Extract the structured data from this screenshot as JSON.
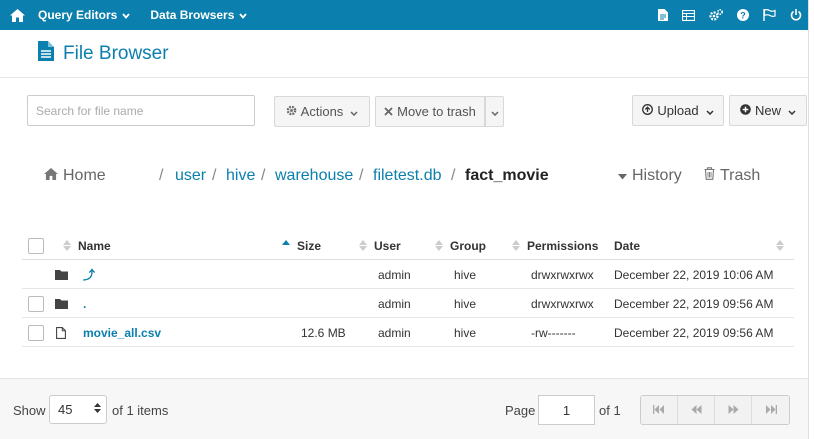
{
  "nav": {
    "query_editors": "Query Editors",
    "data_browsers": "Data Browsers"
  },
  "title": "File Browser",
  "toolbar": {
    "search_placeholder": "Search for file name",
    "actions": "Actions",
    "move_to_trash": "Move to trash",
    "upload": "Upload",
    "new": "New"
  },
  "breadcrumb": {
    "home": "Home",
    "segments": [
      "user",
      "hive",
      "warehouse",
      "filetest.db"
    ],
    "current": "fact_movie",
    "history": "History",
    "trash": "Trash"
  },
  "table": {
    "headers": {
      "name": "Name",
      "size": "Size",
      "user": "User",
      "group": "Group",
      "permissions": "Permissions",
      "date": "Date"
    },
    "rows": [
      {
        "name": "⤴",
        "size": "",
        "user": "admin",
        "group": "hive",
        "permissions": "drwxrwxrwx",
        "date": "December 22, 2019 10:06 AM",
        "type": "folder"
      },
      {
        "name": ".",
        "size": "",
        "user": "admin",
        "group": "hive",
        "permissions": "drwxrwxrwx",
        "date": "December 22, 2019 09:56 AM",
        "type": "folder"
      },
      {
        "name": "movie_all.csv",
        "size": "12.6 MB",
        "user": "admin",
        "group": "hive",
        "permissions": "-rw-------",
        "date": "December 22, 2019 09:56 AM",
        "type": "file"
      }
    ]
  },
  "footer": {
    "show": "Show",
    "page_size": "45",
    "of_items": "of 1 items",
    "page": "Page",
    "page_value": "1",
    "of_pages": "of 1"
  },
  "colors": {
    "accent": "#0b7fad"
  }
}
